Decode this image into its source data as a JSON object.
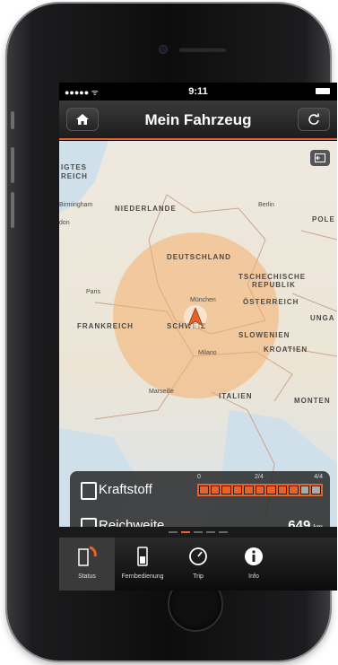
{
  "status_bar": {
    "signal": "●●●●● ᯤ",
    "time": "9:11"
  },
  "nav": {
    "title": "Mein Fahrzeug",
    "home_icon": "home-icon",
    "refresh_icon": "refresh-icon"
  },
  "map": {
    "countries": [
      "NIEDERLANDE",
      "DEUTSCHLAND",
      "TSCHECHISCHE",
      "REPUBLIK",
      "FRANKREICH",
      "SCHWEIZ",
      "ÖSTERREICH",
      "SLOWENIEN",
      "KROATIEN",
      "ITALIEN",
      "MONTEN",
      "POLE",
      "UNGA",
      "IGTES",
      "REICH"
    ],
    "cities": [
      "Birmingham",
      "Berlin",
      "Paris",
      "München",
      "Milano",
      "Marseille",
      "don"
    ]
  },
  "panel": {
    "fuel_label": "Kraftstoff",
    "range_label": "Reichweite",
    "range_value": "649",
    "range_unit": "km",
    "gauge_ticks": [
      "0",
      "2/4",
      "4/4"
    ],
    "fuel_level_fraction": 0.82
  },
  "tabs": [
    {
      "label": "Status"
    },
    {
      "label": "Fernbedienung"
    },
    {
      "label": "Trip"
    },
    {
      "label": "Info"
    }
  ],
  "colors": {
    "accent": "#e8622a",
    "range_circle": "#f5af6e"
  }
}
